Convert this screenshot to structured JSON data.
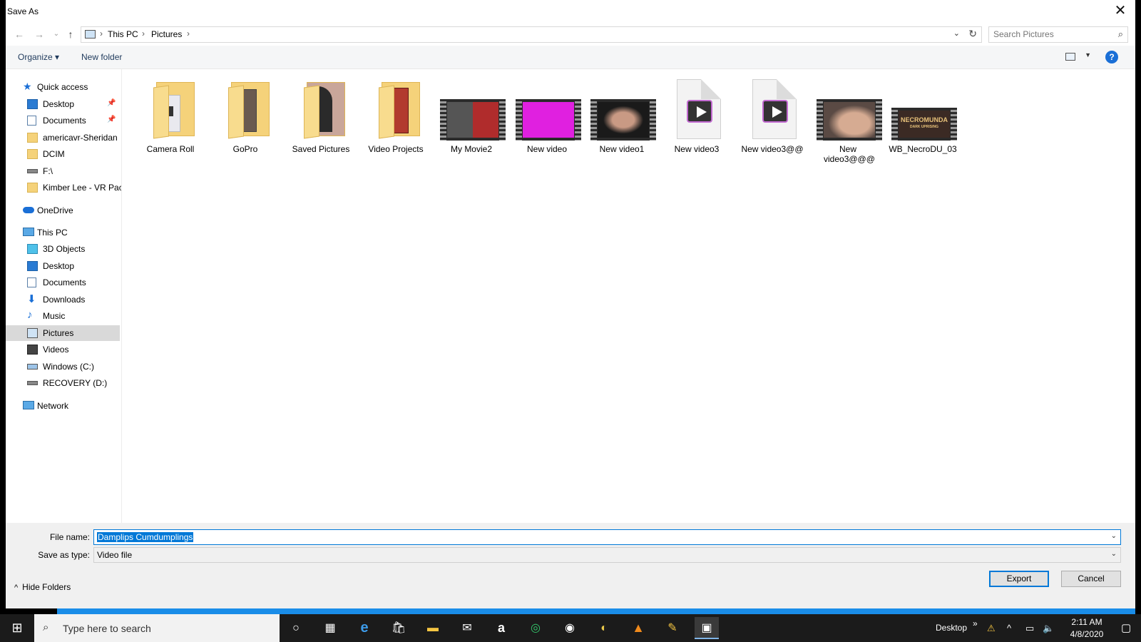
{
  "window": {
    "title": "Save As",
    "close": "✕"
  },
  "nav": {
    "back": "←",
    "forward": "→",
    "recent": "⌄",
    "up": "↑",
    "breadcrumb": [
      "This PC",
      "Pictures"
    ],
    "sep": "›",
    "dropdown": "⌄",
    "refresh": "↻"
  },
  "search": {
    "placeholder": "Search Pictures",
    "icon": "⌕"
  },
  "toolbar": {
    "organize": "Organize ▾",
    "new_folder": "New folder",
    "help": "?",
    "view_dd": "▼"
  },
  "sidebar": {
    "quick_access": "Quick access",
    "quick": [
      {
        "label": "Desktop",
        "pinned": true
      },
      {
        "label": "Documents",
        "pinned": true
      },
      {
        "label": "americavr-Sheridan",
        "pinned": false
      },
      {
        "label": "DCIM",
        "pinned": false
      },
      {
        "label": "F:\\",
        "pinned": false
      },
      {
        "label": "Kimber Lee - VR Pac",
        "pinned": false
      }
    ],
    "onedrive": "OneDrive",
    "this_pc": "This PC",
    "pc": [
      {
        "label": "3D Objects"
      },
      {
        "label": "Desktop"
      },
      {
        "label": "Documents"
      },
      {
        "label": "Downloads"
      },
      {
        "label": "Music"
      },
      {
        "label": "Pictures",
        "selected": true
      },
      {
        "label": "Videos"
      },
      {
        "label": "Windows (C:)"
      },
      {
        "label": "RECOVERY (D:)"
      }
    ],
    "network": "Network",
    "pin_glyph": "📌"
  },
  "files": [
    {
      "name": "Camera Roll",
      "kind": "folder"
    },
    {
      "name": "GoPro",
      "kind": "folder"
    },
    {
      "name": "Saved Pictures",
      "kind": "folder"
    },
    {
      "name": "Video Projects",
      "kind": "folder"
    },
    {
      "name": "My Movie2",
      "kind": "video"
    },
    {
      "name": "New video",
      "kind": "video"
    },
    {
      "name": "New video1",
      "kind": "video"
    },
    {
      "name": "New video3",
      "kind": "doc"
    },
    {
      "name": "New video3@@",
      "kind": "doc"
    },
    {
      "name": "New video3@@@",
      "kind": "video"
    },
    {
      "name": "WB_NecroDU_03",
      "kind": "video",
      "overlay": "NECROMUNDA",
      "overlay_sub": "DARK UPRISING"
    }
  ],
  "form": {
    "file_name_label": "File name:",
    "file_name_value": "Damplips Cumdumplings",
    "type_label": "Save as type:",
    "type_value": "Video file",
    "dd": "⌄"
  },
  "actions": {
    "hide_folders": "Hide Folders",
    "export": "Export",
    "cancel": "Cancel",
    "chevron": "^"
  },
  "taskbar": {
    "search_text": "Type here to search",
    "desktop_label": "Desktop",
    "chevrons": "»",
    "time": "2:11 AM",
    "date": "4/8/2020"
  },
  "colors": {
    "accent": "#0078d7",
    "selection": "#d9d9d9",
    "taskbar": "#1b1b1b",
    "progress": "#1a8de8"
  }
}
